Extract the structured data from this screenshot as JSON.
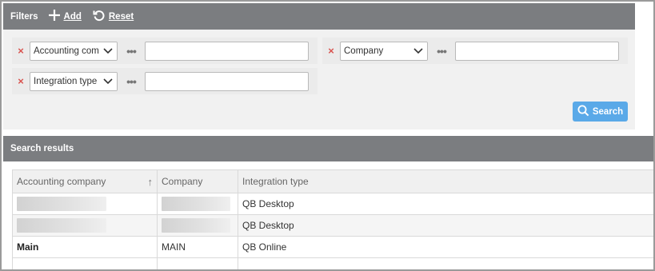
{
  "filters": {
    "title": "Filters",
    "add_label": "Add",
    "reset_label": "Reset",
    "rows": [
      {
        "field": "Accounting com",
        "value": ""
      },
      {
        "field": "Company",
        "value": ""
      },
      {
        "field": "Integration type",
        "value": ""
      }
    ],
    "search_label": "Search"
  },
  "results": {
    "title": "Search results",
    "columns": [
      "Accounting company",
      "Company",
      "Integration type"
    ],
    "rows": [
      {
        "accounting_company": "",
        "company": "",
        "integration_type": "QB Desktop"
      },
      {
        "accounting_company": "",
        "company": "",
        "integration_type": "QB Desktop"
      },
      {
        "accounting_company": "Main",
        "company": "MAIN",
        "integration_type": "QB Online"
      }
    ]
  },
  "colors": {
    "header_bg": "#7b7d80",
    "accent": "#5aa9e8",
    "remove": "#d9534f"
  }
}
